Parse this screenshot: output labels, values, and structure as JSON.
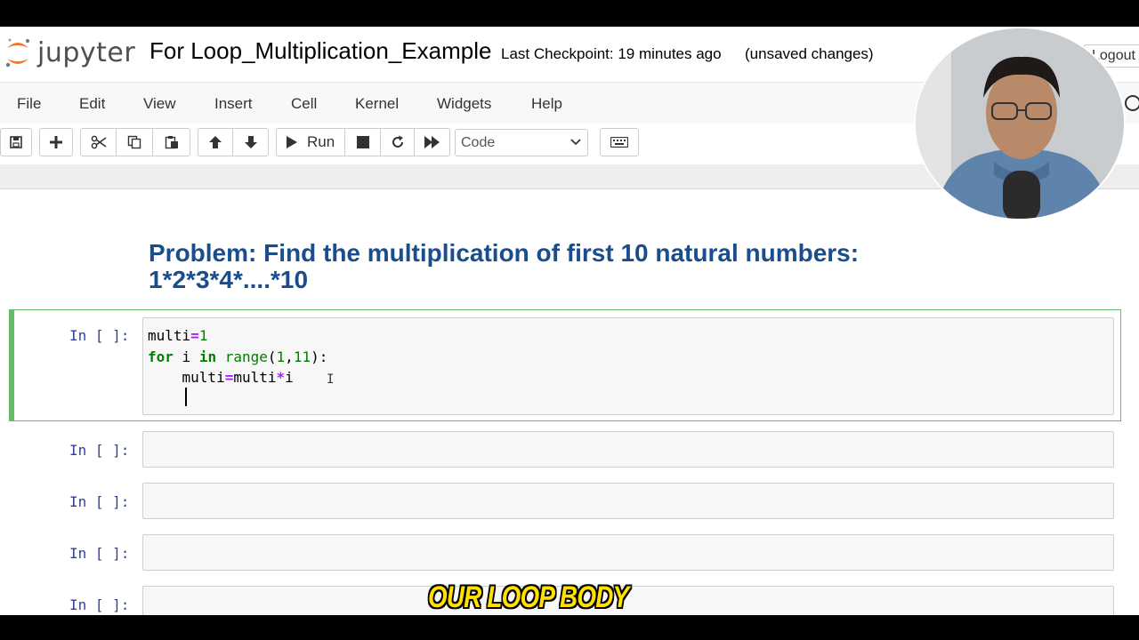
{
  "header": {
    "logo_text": "jupyter",
    "notebook_name": "For Loop_Multiplication_Example",
    "checkpoint": "Last Checkpoint: 19 minutes ago",
    "unsaved": "(unsaved changes)",
    "logout": "Logout"
  },
  "menu": [
    "File",
    "Edit",
    "View",
    "Insert",
    "Cell",
    "Kernel",
    "Widgets",
    "Help"
  ],
  "toolbar": {
    "run_label": "Run",
    "cell_type": "Code"
  },
  "notebook": {
    "title_line1": "Problem: Find the multiplication of first 10 natural numbers:",
    "title_line2": "1*2*3*4*....*10",
    "prompt": "In [ ]:",
    "code_lines": [
      "multi=1",
      "for i in range(1,11):",
      "    multi=multi*i",
      "    "
    ]
  },
  "caption": "OUR LOOP BODY",
  "colors": {
    "heading": "#1a4d8c",
    "selected_cell_border": "#66bb6a",
    "prompt": "#303f9f",
    "caption": "#ffe000"
  }
}
